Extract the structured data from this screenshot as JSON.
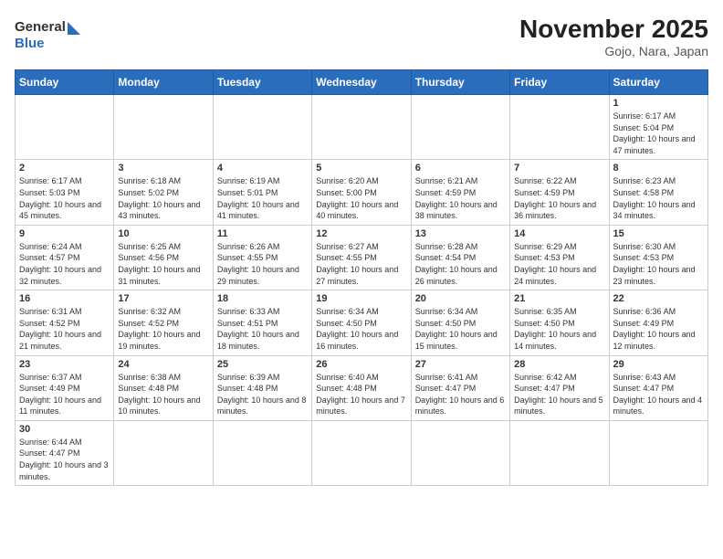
{
  "header": {
    "logo_general": "General",
    "logo_blue": "Blue",
    "month_title": "November 2025",
    "location": "Gojo, Nara, Japan"
  },
  "days_of_week": [
    "Sunday",
    "Monday",
    "Tuesday",
    "Wednesday",
    "Thursday",
    "Friday",
    "Saturday"
  ],
  "weeks": [
    [
      {
        "day": null,
        "info": null
      },
      {
        "day": null,
        "info": null
      },
      {
        "day": null,
        "info": null
      },
      {
        "day": null,
        "info": null
      },
      {
        "day": null,
        "info": null
      },
      {
        "day": null,
        "info": null
      },
      {
        "day": "1",
        "info": "Sunrise: 6:17 AM\nSunset: 5:04 PM\nDaylight: 10 hours and 47 minutes."
      }
    ],
    [
      {
        "day": "2",
        "info": "Sunrise: 6:17 AM\nSunset: 5:03 PM\nDaylight: 10 hours and 45 minutes."
      },
      {
        "day": "3",
        "info": "Sunrise: 6:18 AM\nSunset: 5:02 PM\nDaylight: 10 hours and 43 minutes."
      },
      {
        "day": "4",
        "info": "Sunrise: 6:19 AM\nSunset: 5:01 PM\nDaylight: 10 hours and 41 minutes."
      },
      {
        "day": "5",
        "info": "Sunrise: 6:20 AM\nSunset: 5:00 PM\nDaylight: 10 hours and 40 minutes."
      },
      {
        "day": "6",
        "info": "Sunrise: 6:21 AM\nSunset: 4:59 PM\nDaylight: 10 hours and 38 minutes."
      },
      {
        "day": "7",
        "info": "Sunrise: 6:22 AM\nSunset: 4:59 PM\nDaylight: 10 hours and 36 minutes."
      },
      {
        "day": "8",
        "info": "Sunrise: 6:23 AM\nSunset: 4:58 PM\nDaylight: 10 hours and 34 minutes."
      }
    ],
    [
      {
        "day": "9",
        "info": "Sunrise: 6:24 AM\nSunset: 4:57 PM\nDaylight: 10 hours and 32 minutes."
      },
      {
        "day": "10",
        "info": "Sunrise: 6:25 AM\nSunset: 4:56 PM\nDaylight: 10 hours and 31 minutes."
      },
      {
        "day": "11",
        "info": "Sunrise: 6:26 AM\nSunset: 4:55 PM\nDaylight: 10 hours and 29 minutes."
      },
      {
        "day": "12",
        "info": "Sunrise: 6:27 AM\nSunset: 4:55 PM\nDaylight: 10 hours and 27 minutes."
      },
      {
        "day": "13",
        "info": "Sunrise: 6:28 AM\nSunset: 4:54 PM\nDaylight: 10 hours and 26 minutes."
      },
      {
        "day": "14",
        "info": "Sunrise: 6:29 AM\nSunset: 4:53 PM\nDaylight: 10 hours and 24 minutes."
      },
      {
        "day": "15",
        "info": "Sunrise: 6:30 AM\nSunset: 4:53 PM\nDaylight: 10 hours and 23 minutes."
      }
    ],
    [
      {
        "day": "16",
        "info": "Sunrise: 6:31 AM\nSunset: 4:52 PM\nDaylight: 10 hours and 21 minutes."
      },
      {
        "day": "17",
        "info": "Sunrise: 6:32 AM\nSunset: 4:52 PM\nDaylight: 10 hours and 19 minutes."
      },
      {
        "day": "18",
        "info": "Sunrise: 6:33 AM\nSunset: 4:51 PM\nDaylight: 10 hours and 18 minutes."
      },
      {
        "day": "19",
        "info": "Sunrise: 6:34 AM\nSunset: 4:50 PM\nDaylight: 10 hours and 16 minutes."
      },
      {
        "day": "20",
        "info": "Sunrise: 6:34 AM\nSunset: 4:50 PM\nDaylight: 10 hours and 15 minutes."
      },
      {
        "day": "21",
        "info": "Sunrise: 6:35 AM\nSunset: 4:50 PM\nDaylight: 10 hours and 14 minutes."
      },
      {
        "day": "22",
        "info": "Sunrise: 6:36 AM\nSunset: 4:49 PM\nDaylight: 10 hours and 12 minutes."
      }
    ],
    [
      {
        "day": "23",
        "info": "Sunrise: 6:37 AM\nSunset: 4:49 PM\nDaylight: 10 hours and 11 minutes."
      },
      {
        "day": "24",
        "info": "Sunrise: 6:38 AM\nSunset: 4:48 PM\nDaylight: 10 hours and 10 minutes."
      },
      {
        "day": "25",
        "info": "Sunrise: 6:39 AM\nSunset: 4:48 PM\nDaylight: 10 hours and 8 minutes."
      },
      {
        "day": "26",
        "info": "Sunrise: 6:40 AM\nSunset: 4:48 PM\nDaylight: 10 hours and 7 minutes."
      },
      {
        "day": "27",
        "info": "Sunrise: 6:41 AM\nSunset: 4:47 PM\nDaylight: 10 hours and 6 minutes."
      },
      {
        "day": "28",
        "info": "Sunrise: 6:42 AM\nSunset: 4:47 PM\nDaylight: 10 hours and 5 minutes."
      },
      {
        "day": "29",
        "info": "Sunrise: 6:43 AM\nSunset: 4:47 PM\nDaylight: 10 hours and 4 minutes."
      }
    ],
    [
      {
        "day": "30",
        "info": "Sunrise: 6:44 AM\nSunset: 4:47 PM\nDaylight: 10 hours and 3 minutes."
      },
      {
        "day": null,
        "info": null
      },
      {
        "day": null,
        "info": null
      },
      {
        "day": null,
        "info": null
      },
      {
        "day": null,
        "info": null
      },
      {
        "day": null,
        "info": null
      },
      {
        "day": null,
        "info": null
      }
    ]
  ]
}
